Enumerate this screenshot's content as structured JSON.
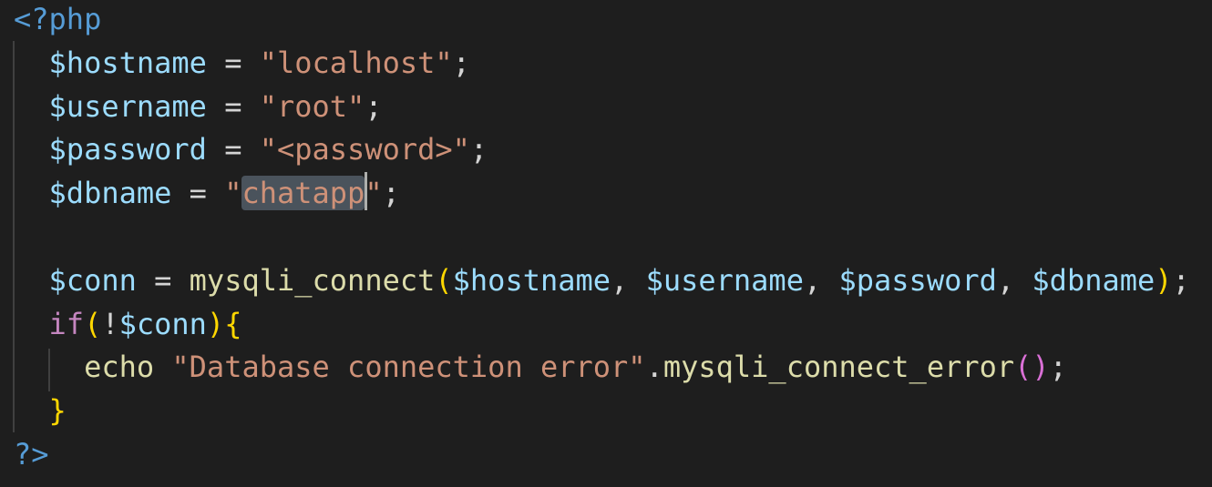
{
  "editor": {
    "language": "php",
    "colors": {
      "background": "#1e1e1e",
      "tag": "#569cd6",
      "variable": "#9cdcfe",
      "string": "#ce9178",
      "function": "#dcdcaa",
      "keyword": "#c586c0",
      "bracket_gold": "#ffd700",
      "bracket_pink": "#da70d6",
      "selection": "#4a535c"
    },
    "selected_text": "chatapp",
    "lines": [
      {
        "indent": 0,
        "tokens": [
          {
            "t": "<?php",
            "c": "tag"
          }
        ]
      },
      {
        "indent": 1,
        "tokens": [
          {
            "t": "$hostname",
            "c": "var"
          },
          {
            "t": " = ",
            "c": "op"
          },
          {
            "t": "\"localhost\"",
            "c": "str"
          },
          {
            "t": ";",
            "c": "op"
          }
        ]
      },
      {
        "indent": 1,
        "tokens": [
          {
            "t": "$username",
            "c": "var"
          },
          {
            "t": " = ",
            "c": "op"
          },
          {
            "t": "\"root\"",
            "c": "str"
          },
          {
            "t": ";",
            "c": "op"
          }
        ]
      },
      {
        "indent": 1,
        "tokens": [
          {
            "t": "$password",
            "c": "var"
          },
          {
            "t": " = ",
            "c": "op"
          },
          {
            "t": "\"<password>\"",
            "c": "str"
          },
          {
            "t": ";",
            "c": "op"
          }
        ]
      },
      {
        "indent": 1,
        "tokens": [
          {
            "t": "$dbname",
            "c": "var"
          },
          {
            "t": " = ",
            "c": "op"
          },
          {
            "t": "\"",
            "c": "str"
          },
          {
            "t": "chatapp",
            "c": "str sel"
          },
          {
            "t": "",
            "c": "cursor"
          },
          {
            "t": "\"",
            "c": "str"
          },
          {
            "t": ";",
            "c": "op"
          }
        ]
      },
      {
        "indent": 0,
        "tokens": []
      },
      {
        "indent": 1,
        "tokens": [
          {
            "t": "$conn",
            "c": "var"
          },
          {
            "t": " = ",
            "c": "op"
          },
          {
            "t": "mysqli_connect",
            "c": "fn"
          },
          {
            "t": "(",
            "c": "b1"
          },
          {
            "t": "$hostname",
            "c": "var"
          },
          {
            "t": ", ",
            "c": "op"
          },
          {
            "t": "$username",
            "c": "var"
          },
          {
            "t": ", ",
            "c": "op"
          },
          {
            "t": "$password",
            "c": "var"
          },
          {
            "t": ", ",
            "c": "op"
          },
          {
            "t": "$dbname",
            "c": "var"
          },
          {
            "t": ")",
            "c": "b1"
          },
          {
            "t": ";",
            "c": "op"
          }
        ]
      },
      {
        "indent": 1,
        "tokens": [
          {
            "t": "if",
            "c": "kw"
          },
          {
            "t": "(",
            "c": "b1"
          },
          {
            "t": "!",
            "c": "op"
          },
          {
            "t": "$conn",
            "c": "var"
          },
          {
            "t": ")",
            "c": "b1"
          },
          {
            "t": "{",
            "c": "b1"
          }
        ]
      },
      {
        "indent": 2,
        "tokens": [
          {
            "t": "echo",
            "c": "fn"
          },
          {
            "t": " ",
            "c": "op"
          },
          {
            "t": "\"Database connection error\"",
            "c": "str"
          },
          {
            "t": ".",
            "c": "op"
          },
          {
            "t": "mysqli_connect_error",
            "c": "fn"
          },
          {
            "t": "(",
            "c": "b2"
          },
          {
            "t": ")",
            "c": "b2"
          },
          {
            "t": ";",
            "c": "op"
          }
        ]
      },
      {
        "indent": 1,
        "tokens": [
          {
            "t": "}",
            "c": "b1"
          }
        ]
      },
      {
        "indent": 0,
        "tokens": [
          {
            "t": "?>",
            "c": "tag"
          }
        ]
      }
    ]
  }
}
